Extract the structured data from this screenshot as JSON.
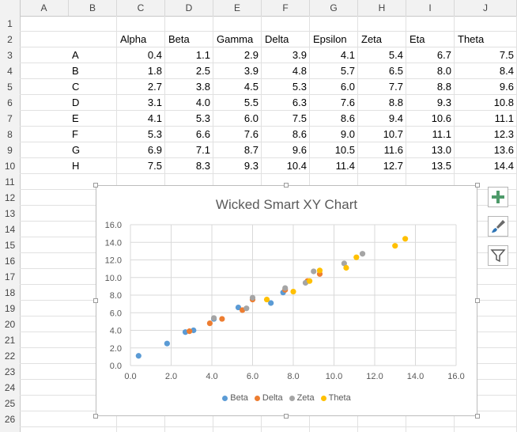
{
  "spreadsheet": {
    "columns": [
      "A",
      "B",
      "C",
      "D",
      "E",
      "F",
      "G",
      "H",
      "I",
      "J"
    ],
    "rows": [
      "1",
      "2",
      "3",
      "4",
      "5",
      "6",
      "7",
      "8",
      "9",
      "10",
      "11",
      "12",
      "13",
      "14",
      "15",
      "16",
      "17",
      "18",
      "19",
      "20",
      "21",
      "22",
      "23",
      "24",
      "25",
      "26"
    ],
    "headers": [
      "Alpha",
      "Beta",
      "Gamma",
      "Delta",
      "Epsilon",
      "Zeta",
      "Eta",
      "Theta"
    ],
    "data_rows": [
      {
        "label": "A",
        "values": [
          "0.4",
          "1.1",
          "2.9",
          "3.9",
          "4.1",
          "5.4",
          "6.7",
          "7.5"
        ]
      },
      {
        "label": "B",
        "values": [
          "1.8",
          "2.5",
          "3.9",
          "4.8",
          "5.7",
          "6.5",
          "8.0",
          "8.4"
        ]
      },
      {
        "label": "C",
        "values": [
          "2.7",
          "3.8",
          "4.5",
          "5.3",
          "6.0",
          "7.7",
          "8.8",
          "9.6"
        ]
      },
      {
        "label": "D",
        "values": [
          "3.1",
          "4.0",
          "5.5",
          "6.3",
          "7.6",
          "8.8",
          "9.3",
          "10.8"
        ]
      },
      {
        "label": "E",
        "values": [
          "4.1",
          "5.3",
          "6.0",
          "7.5",
          "8.6",
          "9.4",
          "10.6",
          "11.1"
        ]
      },
      {
        "label": "F",
        "values": [
          "5.3",
          "6.6",
          "7.6",
          "8.6",
          "9.0",
          "10.7",
          "11.1",
          "12.3"
        ]
      },
      {
        "label": "G",
        "values": [
          "6.9",
          "7.1",
          "8.7",
          "9.6",
          "10.5",
          "11.6",
          "13.0",
          "13.6"
        ]
      },
      {
        "label": "H",
        "values": [
          "7.5",
          "8.3",
          "9.3",
          "10.4",
          "11.4",
          "12.7",
          "13.5",
          "14.4"
        ]
      }
    ]
  },
  "chart_data": {
    "type": "scatter",
    "title": "Wicked Smart XY Chart",
    "xlabel": "",
    "ylabel": "",
    "xlim": [
      0,
      16
    ],
    "ylim": [
      0,
      16
    ],
    "x_ticks": [
      "0.0",
      "2.0",
      "4.0",
      "6.0",
      "8.0",
      "10.0",
      "12.0",
      "14.0",
      "16.0"
    ],
    "y_ticks": [
      "0.0",
      "2.0",
      "4.0",
      "6.0",
      "8.0",
      "10.0",
      "12.0",
      "14.0",
      "16.0"
    ],
    "grid": true,
    "legend_position": "bottom",
    "series": [
      {
        "name": "Beta",
        "color": "#5b9bd5",
        "points": [
          [
            0.4,
            1.1
          ],
          [
            1.8,
            2.5
          ],
          [
            2.7,
            3.8
          ],
          [
            3.1,
            4.0
          ],
          [
            4.1,
            5.3
          ],
          [
            5.3,
            6.6
          ],
          [
            6.9,
            7.1
          ],
          [
            7.5,
            8.3
          ]
        ]
      },
      {
        "name": "Delta",
        "color": "#ed7d31",
        "points": [
          [
            2.9,
            3.9
          ],
          [
            3.9,
            4.8
          ],
          [
            4.5,
            5.3
          ],
          [
            5.5,
            6.3
          ],
          [
            6.0,
            7.5
          ],
          [
            7.6,
            8.6
          ],
          [
            8.7,
            9.6
          ],
          [
            9.3,
            10.4
          ]
        ]
      },
      {
        "name": "Zeta",
        "color": "#a5a5a5",
        "points": [
          [
            4.1,
            5.4
          ],
          [
            5.7,
            6.5
          ],
          [
            6.0,
            7.7
          ],
          [
            7.6,
            8.8
          ],
          [
            8.6,
            9.4
          ],
          [
            9.0,
            10.7
          ],
          [
            10.5,
            11.6
          ],
          [
            11.4,
            12.7
          ]
        ]
      },
      {
        "name": "Theta",
        "color": "#ffc000",
        "points": [
          [
            6.7,
            7.5
          ],
          [
            8.0,
            8.4
          ],
          [
            8.8,
            9.6
          ],
          [
            9.3,
            10.8
          ],
          [
            10.6,
            11.1
          ],
          [
            11.1,
            12.3
          ],
          [
            13.0,
            13.6
          ],
          [
            13.5,
            14.4
          ]
        ]
      }
    ]
  },
  "chart_tools": {
    "add_icon": "plus-icon",
    "style_icon": "paintbrush-icon",
    "filter_icon": "filter-icon"
  }
}
